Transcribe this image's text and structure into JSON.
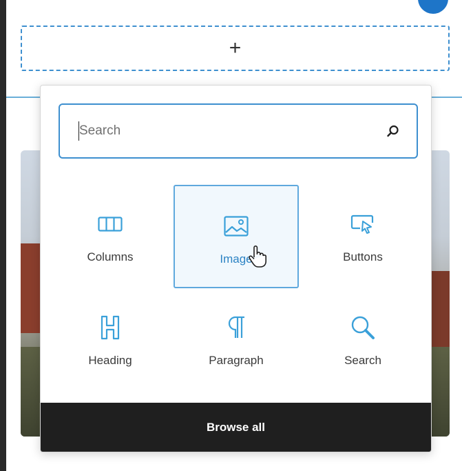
{
  "appender": {
    "label": "+"
  },
  "inserter": {
    "search": {
      "placeholder": "Search",
      "value": ""
    },
    "blocks": [
      {
        "label": "Columns",
        "icon": "columns-icon",
        "selected": false
      },
      {
        "label": "Image",
        "icon": "image-icon",
        "selected": true
      },
      {
        "label": "Buttons",
        "icon": "buttons-icon",
        "selected": false
      },
      {
        "label": "Heading",
        "icon": "heading-icon",
        "selected": false
      },
      {
        "label": "Paragraph",
        "icon": "paragraph-icon",
        "selected": false
      },
      {
        "label": "Search",
        "icon": "search-block-icon",
        "selected": false
      }
    ],
    "browse_all_label": "Browse all"
  },
  "colors": {
    "accent": "#3d8fcf",
    "icon_blue": "#3aa0d9",
    "selected_bg": "#f1f8fd",
    "footer_bg": "#1f1f1f"
  }
}
